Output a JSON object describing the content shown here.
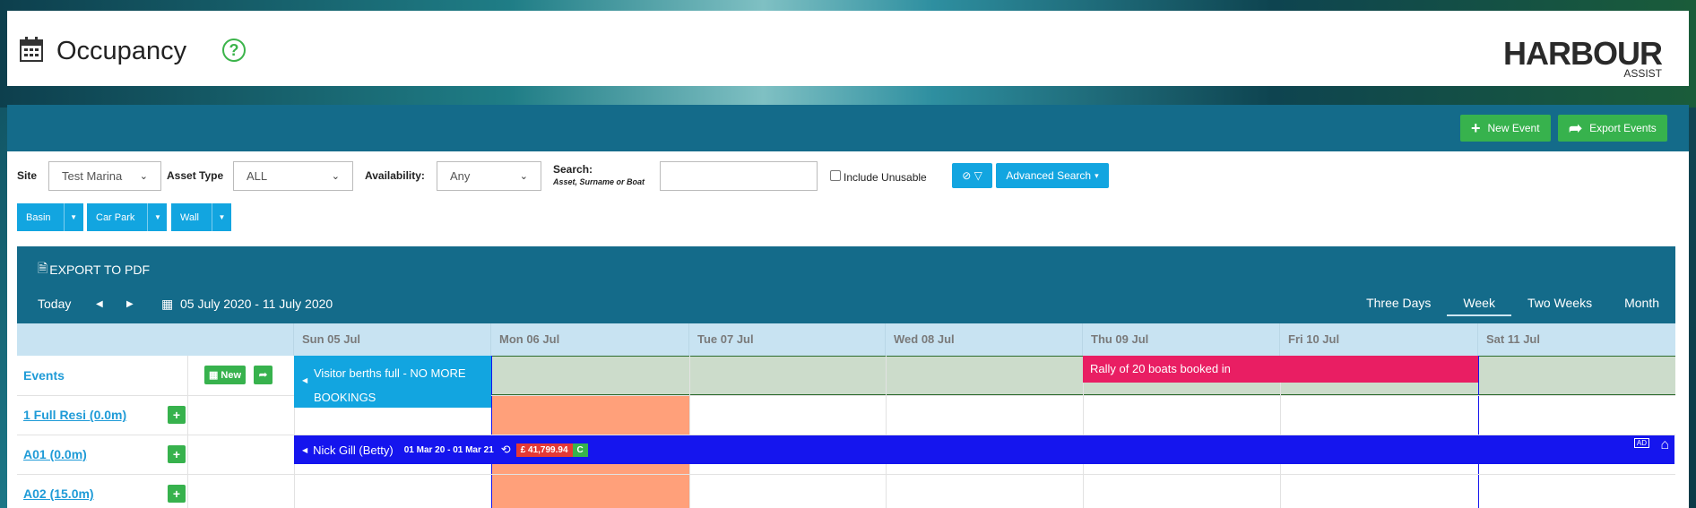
{
  "header": {
    "title": "Occupancy",
    "help": "?",
    "logo_main": "HARBOUR",
    "logo_sub": "ASSIST"
  },
  "toolbar": {
    "new_event": "New Event",
    "export_events": "Export Events"
  },
  "filters": {
    "site_label": "Site",
    "site_value": "Test Marina",
    "asset_type_label": "Asset Type",
    "asset_type_value": "ALL",
    "availability_label": "Availability:",
    "availability_value": "Any",
    "search_label": "Search:",
    "search_hint": "Asset, Surname or Boat",
    "include_unusable": "Include Unusable",
    "advanced_search": "Advanced Search"
  },
  "groups": [
    "Basin",
    "Car Park",
    "Wall"
  ],
  "calendar": {
    "export_pdf": "EXPORT TO PDF",
    "today": "Today",
    "range": "05 July 2020 - 11 July 2020",
    "views": [
      "Three Days",
      "Week",
      "Two Weeks",
      "Month"
    ],
    "active_view": "Week",
    "days": [
      "Sun 05 Jul",
      "Mon 06 Jul",
      "Tue 07 Jul",
      "Wed 08 Jul",
      "Thu 09 Jul",
      "Fri 10 Jul",
      "Sat 11 Jul"
    ],
    "rows": [
      {
        "label": "Events",
        "type": "events"
      },
      {
        "label": "1 Full Resi (0.0m)"
      },
      {
        "label": "A01 (0.0m)"
      },
      {
        "label": "A02 (15.0m)"
      }
    ],
    "events_new": "New",
    "event_1": "Visitor berths full - NO MORE BOOKINGS",
    "event_2": "Rally of 20 boats booked in",
    "booking_name": "Nick Gill (Betty)",
    "booking_dates": "01 Mar 20 - 01 Mar 21",
    "booking_amount": "£ 41,799.94",
    "booking_code": "C",
    "colors": {
      "event_blue": "#12a5e0",
      "event_pink": "#e91e63",
      "booking_blue": "#1515ee",
      "amount_red": "#e53935",
      "green": "#37b24d",
      "orange": "#ffa07a"
    }
  }
}
